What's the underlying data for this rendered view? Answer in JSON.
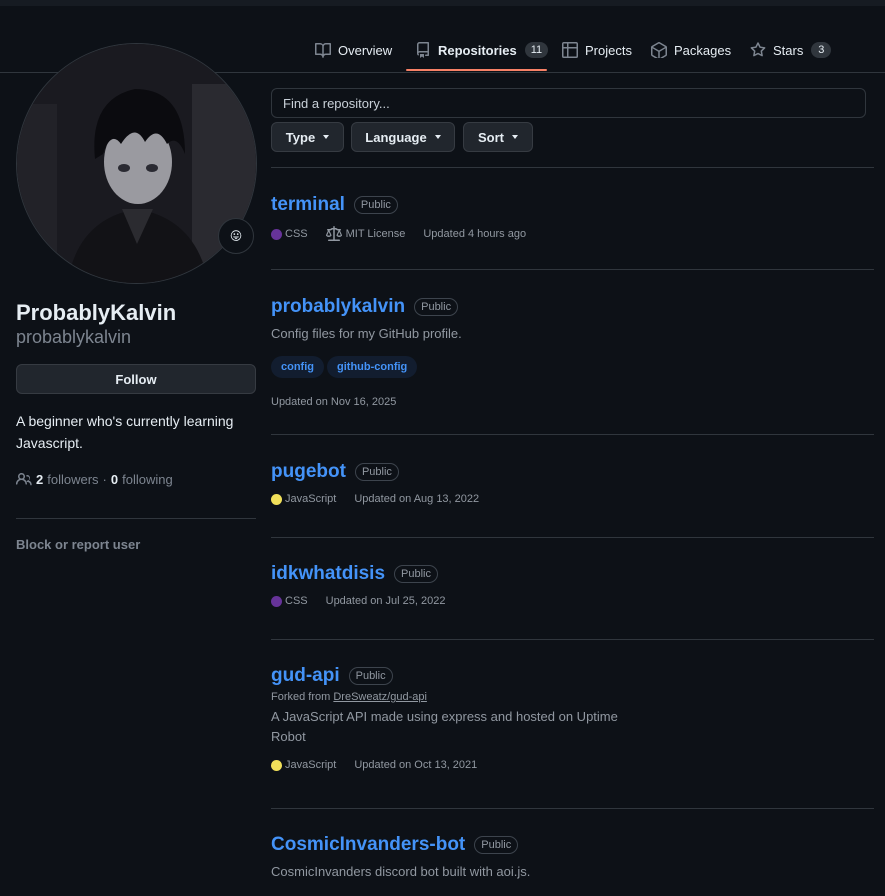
{
  "nav": {
    "tabs": [
      {
        "label": "Overview",
        "icon": "book-icon"
      },
      {
        "label": "Repositories",
        "icon": "repo-icon",
        "count": "11",
        "active": true
      },
      {
        "label": "Projects",
        "icon": "table-icon"
      },
      {
        "label": "Packages",
        "icon": "package-icon"
      },
      {
        "label": "Stars",
        "icon": "star-icon",
        "count": "3"
      }
    ]
  },
  "profile": {
    "name": "ProbablyKalvin",
    "login": "probablykalvin",
    "status_emoji": "😛",
    "follow_label": "Follow",
    "bio": "A beginner who's currently learning Javascript.",
    "followers_count": "2",
    "followers_label": "followers",
    "separator": "·",
    "following_count": "0",
    "following_label": "following",
    "block_label": "Block or report user"
  },
  "search": {
    "placeholder": "Find a repository..."
  },
  "filters": {
    "type": "Type",
    "language": "Language",
    "sort": "Sort"
  },
  "repos": [
    {
      "name": "terminal",
      "visibility": "Public",
      "language": "CSS",
      "lang_color": "#663399",
      "license": "MIT License",
      "updated": "Updated 4 hours ago"
    },
    {
      "name": "probablykalvin",
      "visibility": "Public",
      "description": "Config files for my GitHub profile.",
      "topics": [
        "config",
        "github-config"
      ],
      "updated": "Updated on Nov 16, 2025"
    },
    {
      "name": "pugebot",
      "visibility": "Public",
      "language": "JavaScript",
      "lang_color": "#f1e05a",
      "updated": "Updated on Aug 13, 2022"
    },
    {
      "name": "idkwhatdisis",
      "visibility": "Public",
      "language": "CSS",
      "lang_color": "#663399",
      "updated": "Updated on Jul 25, 2022"
    },
    {
      "name": "gud-api",
      "visibility": "Public",
      "fork_prefix": "Forked from",
      "fork_source": "DreSweatz/gud-api",
      "description": "A JavaScript API made using express and hosted on Uptime Robot",
      "language": "JavaScript",
      "lang_color": "#f1e05a",
      "updated": "Updated on Oct 13, 2021"
    },
    {
      "name": "CosmicInvanders-bot",
      "visibility": "Public",
      "description": "CosmicInvanders discord bot built with aoi.js."
    }
  ]
}
